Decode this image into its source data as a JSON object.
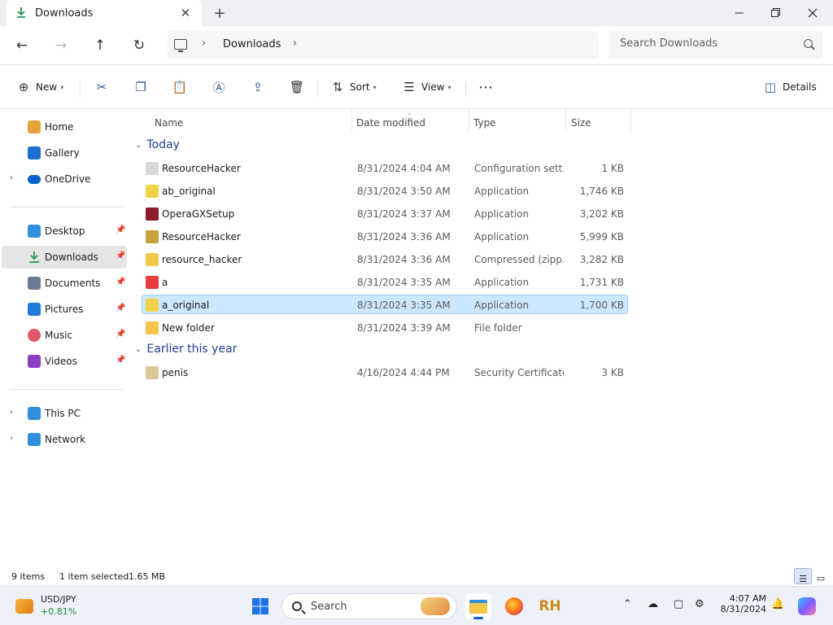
{
  "tab": {
    "title": "Downloads"
  },
  "breadcrumb": {
    "current": "Downloads"
  },
  "search": {
    "placeholder": "Search Downloads"
  },
  "commands": {
    "new": "New",
    "sort": "Sort",
    "view": "View",
    "details": "Details"
  },
  "sidebar": {
    "top": [
      {
        "label": "Home",
        "icon": "home-icon",
        "color": "#e2a33a"
      },
      {
        "label": "Gallery",
        "icon": "gallery-icon",
        "color": "#1d6fd1"
      },
      {
        "label": "OneDrive",
        "icon": "onedrive-icon",
        "color": "#0a62c8"
      }
    ],
    "pinned": [
      {
        "label": "Desktop",
        "icon": "desktop-icon",
        "color": "#2f8fdd"
      },
      {
        "label": "Downloads",
        "icon": "downloads-icon",
        "color": "#1c9a55"
      },
      {
        "label": "Documents",
        "icon": "documents-icon",
        "color": "#6b7b93"
      },
      {
        "label": "Pictures",
        "icon": "pictures-icon",
        "color": "#1f7ad6"
      },
      {
        "label": "Music",
        "icon": "music-icon",
        "color": "#e0566a"
      },
      {
        "label": "Videos",
        "icon": "videos-icon",
        "color": "#8a3fc4"
      }
    ],
    "bottom": [
      {
        "label": "This PC",
        "icon": "this-pc-icon",
        "color": "#2f8fdd"
      },
      {
        "label": "Network",
        "icon": "network-icon",
        "color": "#2f8fdd"
      }
    ]
  },
  "columns": {
    "name": "Name",
    "date": "Date modified",
    "type": "Type",
    "size": "Size"
  },
  "groups": {
    "today": "Today",
    "earlier": "Earlier this year"
  },
  "files_today": [
    {
      "name": "ResourceHacker",
      "date": "8/31/2024 4:04 AM",
      "type": "Configuration sett...",
      "size": "1 KB",
      "icon": "config-file-icon",
      "color": "#d9d9d9"
    },
    {
      "name": "ab_original",
      "date": "8/31/2024 3:50 AM",
      "type": "Application",
      "size": "1,746 KB",
      "icon": "app-icon",
      "color": "#f0d24a"
    },
    {
      "name": "OperaGXSetup",
      "date": "8/31/2024 3:37 AM",
      "type": "Application",
      "size": "3,202 KB",
      "icon": "opera-gx-icon",
      "color": "#8c1b2e"
    },
    {
      "name": "ResourceHacker",
      "date": "8/31/2024 3:36 AM",
      "type": "Application",
      "size": "5,999 KB",
      "icon": "resource-hacker-icon",
      "color": "#c8a13a"
    },
    {
      "name": "resource_hacker",
      "date": "8/31/2024 3:36 AM",
      "type": "Compressed (zipp...",
      "size": "3,282 KB",
      "icon": "zip-folder-icon",
      "color": "#f2c94c"
    },
    {
      "name": "a",
      "date": "8/31/2024 3:35 AM",
      "type": "Application",
      "size": "1,731 KB",
      "icon": "opera-icon",
      "color": "#e53d3d"
    },
    {
      "name": "a_original",
      "date": "8/31/2024 3:35 AM",
      "type": "Application",
      "size": "1,700 KB",
      "icon": "app-icon",
      "color": "#f0d24a",
      "selected": true
    },
    {
      "name": "New folder",
      "date": "8/31/2024 3:39 AM",
      "type": "File folder",
      "size": "",
      "icon": "folder-icon",
      "color": "#f5c54a"
    }
  ],
  "files_earlier": [
    {
      "name": "penis",
      "date": "4/16/2024 4:44 PM",
      "type": "Security Certificate",
      "size": "3 KB",
      "icon": "certificate-icon",
      "color": "#d8c89a"
    }
  ],
  "status": {
    "count": "9 items",
    "selection": "1 item selected",
    "selection_size": "1.65 MB"
  },
  "taskbar": {
    "widget_title": "USD/JPY",
    "widget_value": "+0.81%",
    "search_label": "Search",
    "time": "4:07 AM",
    "date": "8/31/2024"
  }
}
